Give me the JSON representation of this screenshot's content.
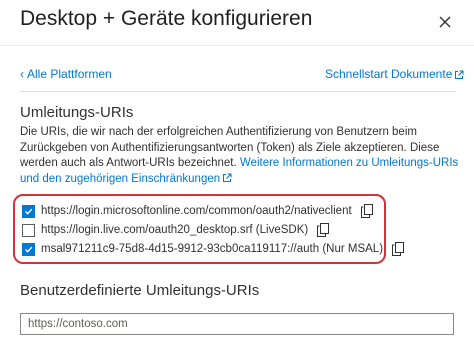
{
  "header": {
    "title": "Desktop + Geräte konfigurieren",
    "close_icon": "close-icon"
  },
  "toolbar": {
    "back_label": "Alle Plattformen",
    "quickstart_label": "Schnellstart",
    "docs_label": "Dokumente"
  },
  "redirect": {
    "heading": "Umleitungs-URIs",
    "description": "Die URIs, die wir nach der erfolgreichen Authentifizierung von Benutzern beim Zurückgeben von Authentifizierungsantworten (Token) als Ziele akzeptieren. Diese werden auch als Antwort-URIs bezeichnet.",
    "more_link": "Weitere Informationen zu Umleitungs-URIs und den zugehörigen Einschränkungen",
    "uris": [
      {
        "text": "https://login.microsoftonline.com/common/oauth2/nativeclient",
        "checked": true
      },
      {
        "text": "https://login.live.com/oauth20_desktop.srf (LiveSDK)",
        "checked": false
      },
      {
        "text": "msal971211c9-75d8-4d15-9912-93cb0ca119117://auth (Nur MSAL)",
        "checked": true
      }
    ]
  },
  "custom": {
    "heading": "Benutzerdefinierte Umleitungs-URIs",
    "placeholder": "https://contoso.com"
  },
  "colors": {
    "accent": "#0078d4",
    "highlight_border": "#d13438"
  }
}
